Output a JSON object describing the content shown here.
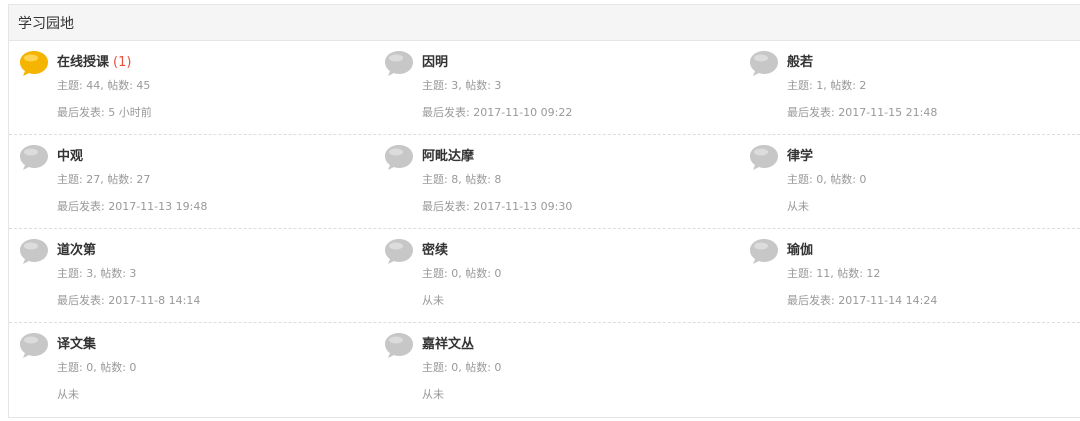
{
  "header": {
    "title": "学习园地"
  },
  "colors": {
    "new_icon": "#f4b400",
    "old_icon": "#c7c7c7",
    "new_count": "#e8503a"
  },
  "forums": [
    {
      "name": "在线授课",
      "new_badge": "(1)",
      "has_new": true,
      "stats": "主题: 44, 帖数: 45",
      "last": "最后发表: 5 小时前"
    },
    {
      "name": "因明",
      "new_badge": "",
      "has_new": false,
      "stats": "主题: 3, 帖数: 3",
      "last": "最后发表: 2017-11-10 09:22"
    },
    {
      "name": "般若",
      "new_badge": "",
      "has_new": false,
      "stats": "主题: 1, 帖数: 2",
      "last": "最后发表: 2017-11-15 21:48"
    },
    {
      "name": "中观",
      "new_badge": "",
      "has_new": false,
      "stats": "主题: 27, 帖数: 27",
      "last": "最后发表: 2017-11-13 19:48"
    },
    {
      "name": "阿毗达摩",
      "new_badge": "",
      "has_new": false,
      "stats": "主题: 8, 帖数: 8",
      "last": "最后发表: 2017-11-13 09:30"
    },
    {
      "name": "律学",
      "new_badge": "",
      "has_new": false,
      "stats": "主题: 0, 帖数: 0",
      "last": "从未"
    },
    {
      "name": "道次第",
      "new_badge": "",
      "has_new": false,
      "stats": "主题: 3, 帖数: 3",
      "last": "最后发表: 2017-11-8 14:14"
    },
    {
      "name": "密续",
      "new_badge": "",
      "has_new": false,
      "stats": "主题: 0, 帖数: 0",
      "last": "从未"
    },
    {
      "name": "瑜伽",
      "new_badge": "",
      "has_new": false,
      "stats": "主题: 11, 帖数: 12",
      "last": "最后发表: 2017-11-14 14:24"
    },
    {
      "name": "译文集",
      "new_badge": "",
      "has_new": false,
      "stats": "主题: 0, 帖数: 0",
      "last": "从未"
    },
    {
      "name": "嘉祥文丛",
      "new_badge": "",
      "has_new": false,
      "stats": "主题: 0, 帖数: 0",
      "last": "从未"
    }
  ]
}
